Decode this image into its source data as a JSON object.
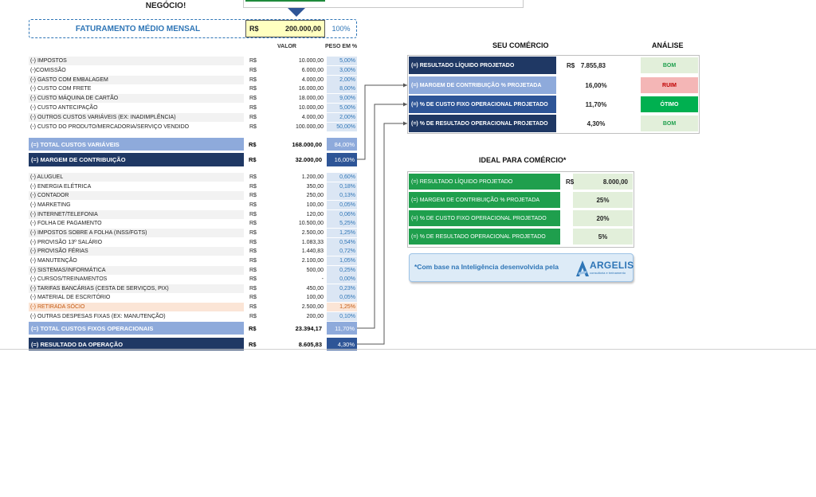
{
  "header": {
    "negocio_text": "NEGÓCIO!"
  },
  "faturamento": {
    "label": "FATURAMENTO MÉDIO MENSAL",
    "currency": "R$",
    "value": "200.000,00",
    "pct": "100%"
  },
  "table_headers": {
    "valor": "VALOR",
    "peso": "PESO EM %"
  },
  "variable_costs": [
    {
      "label": "(-) IMPOSTOS",
      "currency": "R$",
      "value": "10.000,00",
      "pct": "5,00%"
    },
    {
      "label": "(-)COMISSÃO",
      "currency": "R$",
      "value": "6.000,00",
      "pct": "3,00%"
    },
    {
      "label": "(-) GASTO COM EMBALAGEM",
      "currency": "R$",
      "value": "4.000,00",
      "pct": "2,00%"
    },
    {
      "label": "(-) CUSTO COM FRETE",
      "currency": "R$",
      "value": "16.000,00",
      "pct": "8,00%"
    },
    {
      "label": "(-) CUSTO MÁQUINA DE CARTÃO",
      "currency": "R$",
      "value": "18.000,00",
      "pct": "9,00%"
    },
    {
      "label": "(-) CUSTO ANTECIPAÇÃO",
      "currency": "R$",
      "value": "10.000,00",
      "pct": "5,00%"
    },
    {
      "label": "(-)  OUTROS CUSTOS VARIÁVEIS (EX: INADIMPLÊNCIA)",
      "currency": "R$",
      "value": "4.000,00",
      "pct": "2,00%"
    },
    {
      "label": "(-) CUSTO DO PRODUTO/MERCADORIA/SERVIÇO VENDIDO",
      "currency": "R$",
      "value": "100.000,00",
      "pct": "50,00%"
    }
  ],
  "total_variaveis": {
    "label": "(=) TOTAL CUSTOS VARIÁVEIS",
    "currency": "R$",
    "value": "168.000,00",
    "pct": "84,00%"
  },
  "margem": {
    "label": "(=) MARGEM DE CONTRIBUIÇÃO",
    "currency": "R$",
    "value": "32.000,00",
    "pct": "16,00%"
  },
  "fixed_costs": [
    {
      "label": "(-) ALUGUEL",
      "currency": "R$",
      "value": "1.200,00",
      "pct": "0,60%"
    },
    {
      "label": "(-) ENERGIA ELÉTRICA",
      "currency": "R$",
      "value": "350,00",
      "pct": "0,18%"
    },
    {
      "label": "(-) CONTADOR",
      "currency": "R$",
      "value": "250,00",
      "pct": "0,13%"
    },
    {
      "label": "(-) MARKETING",
      "currency": "R$",
      "value": "100,00",
      "pct": "0,05%"
    },
    {
      "label": "(-) INTERNET/TELEFONIA",
      "currency": "R$",
      "value": "120,00",
      "pct": "0,06%"
    },
    {
      "label": "(-) FOLHA DE PAGAMENTO",
      "currency": "R$",
      "value": "10.500,00",
      "pct": "5,25%"
    },
    {
      "label": "(-) IMPOSTOS SOBRE A FOLHA (INSS/FGTS)",
      "currency": "R$",
      "value": "2.500,00",
      "pct": "1,25%"
    },
    {
      "label": "(-) PROVISÃO 13º SALÁRIO",
      "currency": "R$",
      "value": "1.083,33",
      "pct": "0,54%"
    },
    {
      "label": "(-) PROVISÃO FÉRIAS",
      "currency": "R$",
      "value": "1.440,83",
      "pct": "0,72%"
    },
    {
      "label": "(-) MANUTENÇÃO",
      "currency": "R$",
      "value": "2.100,00",
      "pct": "1,05%"
    },
    {
      "label": "(-) SISTEMAS/INFORMÁTICA",
      "currency": "R$",
      "value": "500,00",
      "pct": "0,25%"
    },
    {
      "label": "(-) CURSOS/TREINAMENTOS",
      "currency": "R$",
      "value": "-",
      "pct": "0,00%"
    },
    {
      "label": "(-) TARIFAS BANCÁRIAS (CESTA DE SERVIÇOS, PIX)",
      "currency": "R$",
      "value": "450,00",
      "pct": "0,23%"
    },
    {
      "label": "(-) MATERIAL DE ESCRITÓRIO",
      "currency": "R$",
      "value": "100,00",
      "pct": "0,05%"
    },
    {
      "label": "(-) RETIRADA SÓCIO",
      "currency": "R$",
      "value": "2.500,00",
      "pct": "1,25%"
    },
    {
      "label": "(-) OUTRAS DESPESAS FIXAS (EX: MANUTENÇÃO)",
      "currency": "R$",
      "value": "200,00",
      "pct": "0,10%"
    }
  ],
  "total_fixos": {
    "label": "(=) TOTAL CUSTOS FIXOS OPERACIONAIS",
    "currency": "R$",
    "value": "23.394,17",
    "pct": "11,70%"
  },
  "resultado": {
    "label": "(=) RESULTADO DA OPERAÇÃO",
    "currency": "R$",
    "value": "8.605,83",
    "pct": "4,30%"
  },
  "seu_comercio": {
    "title": "SEU COMÉRCIO",
    "analise_title": "ANÁLISE",
    "rows": [
      {
        "label": "(=) RESULTADO LÍQUIDO PROJETADO",
        "currency": "R$",
        "value": "7.855,83",
        "status": "BOM",
        "status_bg": "#e2efda",
        "status_color": "#1f9f4d"
      },
      {
        "label": "(=) MARGEM DE CONTRIBUIÇÃO % PROJETADA",
        "currency": "",
        "value": "16,00%",
        "status": "RUIM",
        "status_bg": "#f4b6b6",
        "status_color": "#c00000"
      },
      {
        "label": "(=) % DE CUSTO FIXO OPERACIONAL PROJETADO",
        "currency": "",
        "value": "11,70%",
        "status": "ÓTIMO",
        "status_bg": "#00b050",
        "status_color": "#ffffff"
      },
      {
        "label": "(=) % DE RESULTADO OPERACIONAL PROJETADO",
        "currency": "",
        "value": "4,30%",
        "status": "BOM",
        "status_bg": "#e2efda",
        "status_color": "#1f9f4d"
      }
    ]
  },
  "ideal": {
    "title": "IDEAL PARA COMÉRCIO*",
    "rows": [
      {
        "label": "(=) RESULTADO LÍQUIDO PROJETADO",
        "currency": "R$",
        "value": "8.000,00"
      },
      {
        "label": "(=) MARGEM DE CONTRIBUIÇÃO % PROJETADA",
        "currency": "",
        "value": "25%"
      },
      {
        "label": "(=) % DE CUSTO FIXO OPERACIONAL PROJETADO",
        "currency": "",
        "value": "20%"
      },
      {
        "label": "(=) % DE RESULTADO OPERACIONAL PROJETADO",
        "currency": "",
        "value": "5%"
      }
    ]
  },
  "argelis": {
    "note": "*Com base na Inteligência desenvolvida pela",
    "logo_name": "ARGELIS",
    "logo_sub": "consultoria e treinamento"
  },
  "colors": {
    "dark_navy": "#1f3864",
    "mid_blue": "#2e5597",
    "light_blue": "#8eaadb",
    "accent_blue": "#2e75b6",
    "green": "#1f9f4d"
  }
}
